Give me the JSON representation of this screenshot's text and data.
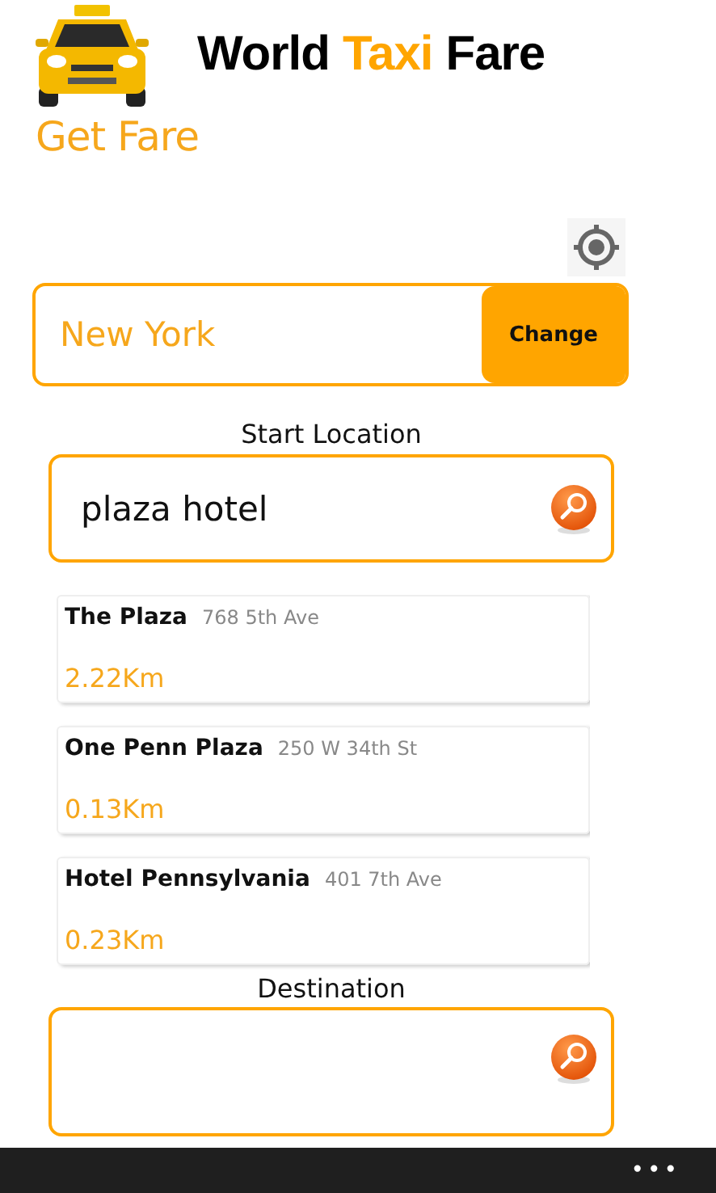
{
  "header": {
    "title": [
      {
        "text": "World",
        "accent": false
      },
      {
        "text": "Taxi",
        "accent": true
      },
      {
        "text": "Fare",
        "accent": false
      }
    ]
  },
  "page_title": "Get Fare",
  "city": {
    "value": "New York",
    "button": "Change"
  },
  "start": {
    "label": "Start Location",
    "value": "plaza hotel"
  },
  "results": [
    {
      "name": "The Plaza",
      "address": "768 5th Ave",
      "distance": "2.22Km"
    },
    {
      "name": "One Penn Plaza",
      "address": "250 W 34th St",
      "distance": "0.13Km"
    },
    {
      "name": "Hotel Pennsylvania",
      "address": "401 7th Ave",
      "distance": "0.23Km"
    }
  ],
  "destination": {
    "label": "Destination"
  },
  "app_bar": {
    "more": "•••"
  }
}
